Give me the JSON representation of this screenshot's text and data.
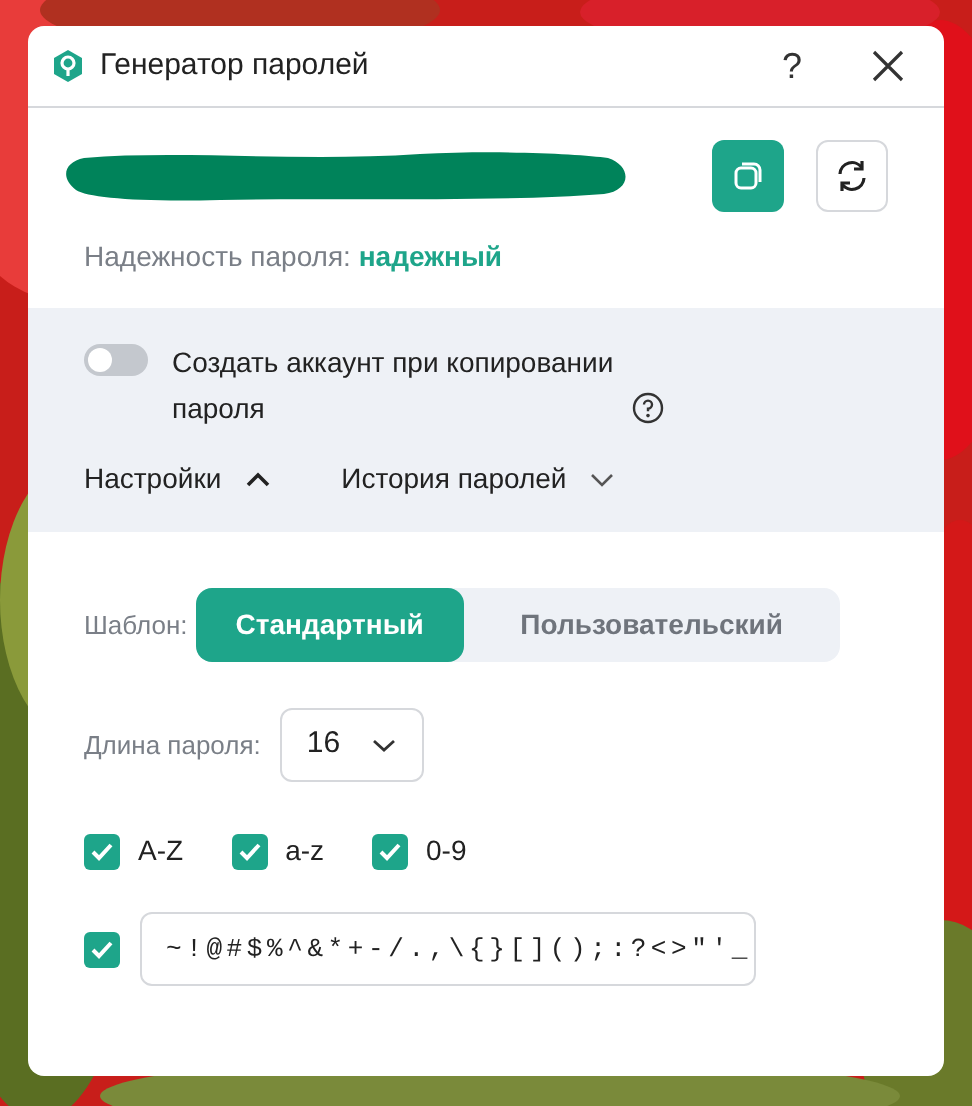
{
  "window": {
    "title": "Генератор паролей",
    "help": "?"
  },
  "password": {
    "strength_label": "Надежность пароля:",
    "strength": "надежный"
  },
  "account_toggle": {
    "label": "Создать аккаунт при копировании пароля",
    "on": false
  },
  "sections": [
    {
      "label": "Настройки",
      "expanded": true
    },
    {
      "label": "История паролей",
      "expanded": false
    }
  ],
  "template": {
    "label": "Шаблон:",
    "options": [
      {
        "label": "Стандартный",
        "selected": true
      },
      {
        "label": "Пользовательский",
        "selected": false
      }
    ]
  },
  "length": {
    "label": "Длина пароля:",
    "value": "16"
  },
  "charsets": [
    {
      "label": "A-Z",
      "checked": true
    },
    {
      "label": "a-z",
      "checked": true
    },
    {
      "label": "0-9",
      "checked": true
    }
  ],
  "special": {
    "checked": true,
    "value": "~!@#$%^&*+-/.,\\{}[]();:?<>\"'_"
  }
}
